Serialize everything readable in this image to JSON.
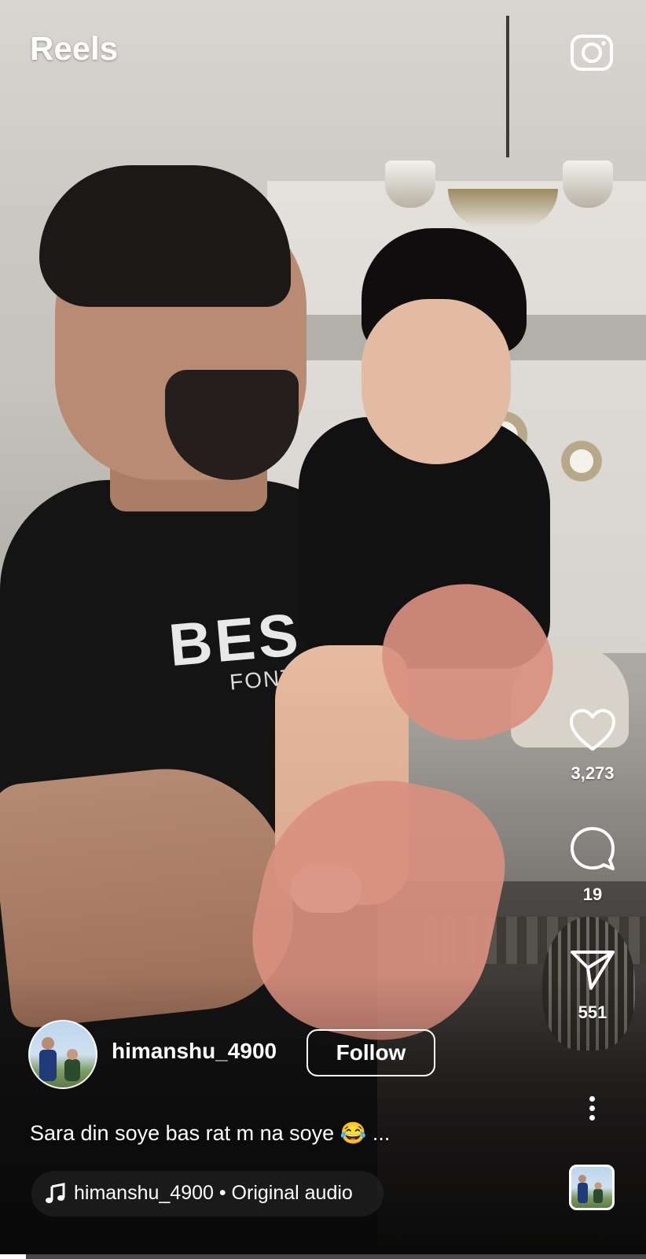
{
  "header": {
    "title": "Reels",
    "camera_icon": "camera-icon"
  },
  "actions": {
    "like": {
      "icon": "heart-icon",
      "count": "3,273"
    },
    "comment": {
      "icon": "comment-bubble-icon",
      "count": "19"
    },
    "share": {
      "icon": "paper-plane-icon",
      "count": "551"
    },
    "more_icon": "more-vertical-icon"
  },
  "post": {
    "username": "himanshu_4900",
    "follow_label": "Follow",
    "caption": "Sara din soye bas rat m na soye 😂 ...",
    "audio_label": "himanshu_4900 • Original audio",
    "audio_icon": "music-note-icon"
  },
  "video_overlay_text": {
    "shirt_main": "BES",
    "shirt_sub": "FONTDOG"
  },
  "playback": {
    "progress": 0.04
  },
  "colors": {
    "text": "#ffffff",
    "background": "#000000"
  }
}
